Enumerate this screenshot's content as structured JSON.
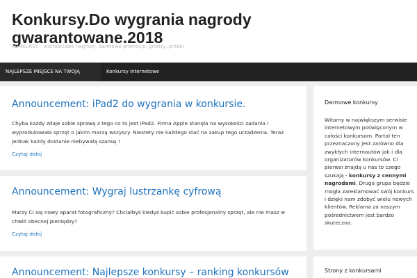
{
  "header": {
    "site_title": "Konkursy.Do wygrania nagrody gwarantowane.2018",
    "site_description": "KONKURSY – wartościowe nagrody, darmowe promocje, gratisy, próbki"
  },
  "nav": {
    "items": [
      {
        "label": "NAJLEPSZE MIEJSCE NA TWOJĄ REKLAMĘ"
      },
      {
        "label": "Konkursy internetowe"
      }
    ]
  },
  "posts": [
    {
      "title": "Announcement: iPad2 do wygrania w konkursie.",
      "body": "Chyba każdy zdaje sobie sprawę z tego co to jest iPad2. Firma Apple stanęła na wysokości zadania i wyprodukowała sprzęt o jakim marzą wszyscy. Niestety nie każdego stać na zakup tego urządzenia. Teraz jednak każdy dostanie niebywałą szansę !",
      "read_more": "Czytaj dalej"
    },
    {
      "title": "Announcement: Wygraj lustrzankę cyfrową",
      "body": "Marzy Ci się nowy aparat fotograficzny? Chciałbyś kiedyś kupić sobie profesjonalny sprzęt, ale nie masz w chwili obecnej pieniędzy?",
      "read_more": "Czytaj dalej"
    },
    {
      "title": "Announcement: Najlepsze konkursy – ranking konkursów"
    }
  ],
  "sidebar": {
    "widget1": {
      "title": "Darmowe konkursy",
      "text_before": "Witamy w największym serwisie internetowym poświęconym w całości konkursom. Portal ten przeznaczony jest zarówno dla zwykłych internautów jak i dla organizatorów konkursów. Ci pierwsi znajdą u nas to czego szukają - ",
      "text_bold": "konkursy z cennymi nagrodami",
      "text_after": ". Druga grupa będzie mogła zareklamować swój konkurs i dzięki nam zdobyć wielu nowych klientów. Reklama za naszym pośrednictwem jest bardzo skuteczna."
    },
    "widget2": {
      "title": "Strony z konkursami"
    }
  }
}
